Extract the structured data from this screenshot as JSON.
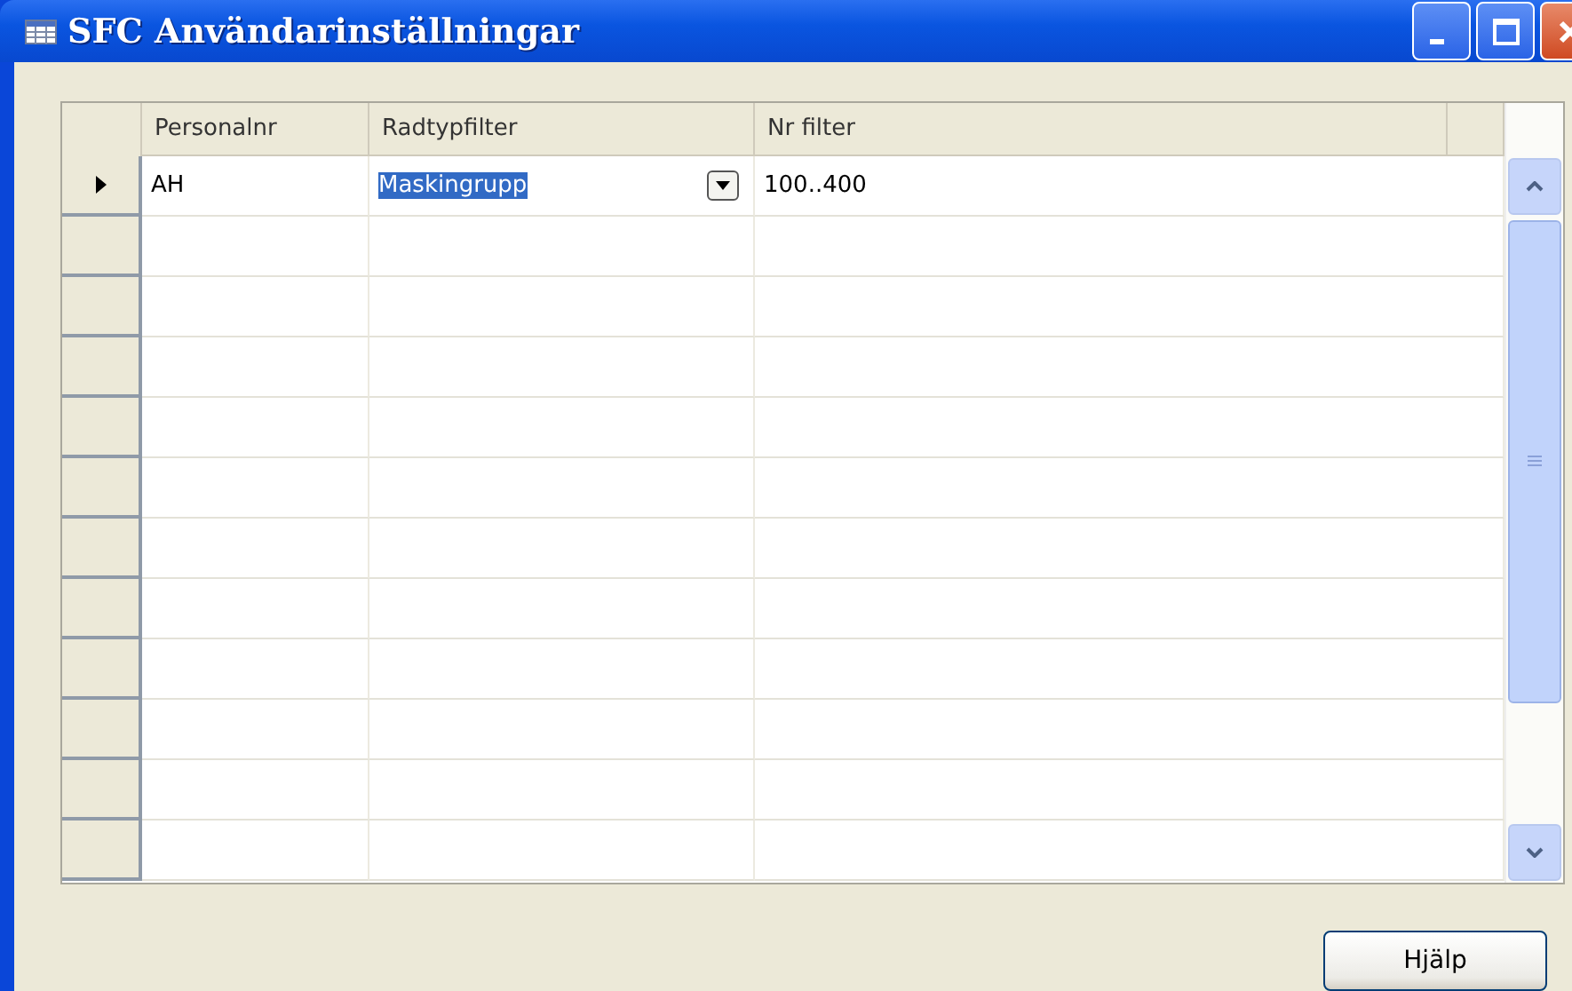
{
  "window": {
    "title": "SFC Användarinställningar"
  },
  "table": {
    "columns": [
      "Personalnr",
      "Radtypfilter",
      "Nr filter"
    ],
    "rows": [
      {
        "current": true,
        "cells": [
          {
            "text": "AH",
            "selected": false,
            "dropdown": false
          },
          {
            "text": "Maskingrupp",
            "selected": true,
            "dropdown": true
          },
          {
            "text": "100..400",
            "selected": false,
            "dropdown": false
          }
        ]
      },
      {
        "current": false
      },
      {
        "current": false
      },
      {
        "current": false
      },
      {
        "current": false
      },
      {
        "current": false
      },
      {
        "current": false
      },
      {
        "current": false
      },
      {
        "current": false
      },
      {
        "current": false
      },
      {
        "current": false
      },
      {
        "current": false
      }
    ]
  },
  "buttons": [
    {
      "label": "Hjälp"
    }
  ]
}
